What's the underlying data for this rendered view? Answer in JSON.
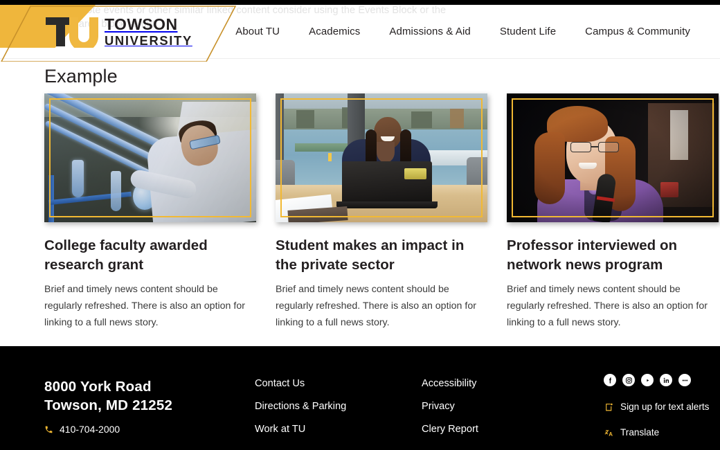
{
  "hint": {
    "line1": "To promote events or other similar linked content consider using the Events Block or the",
    "line1_link": "Events Block",
    "line2": "Link Cards block layout."
  },
  "header": {
    "logo": {
      "monogram": "TU",
      "name_top": "TOWSON",
      "name_bottom": "UNIVERSITY"
    },
    "nav": [
      {
        "label": "About TU"
      },
      {
        "label": "Academics"
      },
      {
        "label": "Admissions & Aid"
      },
      {
        "label": "Student Life"
      },
      {
        "label": "Campus & Community"
      }
    ]
  },
  "main": {
    "title": "Example",
    "cards": [
      {
        "title": "College faculty awarded research grant",
        "body": "Brief and timely news content should be regularly refreshed. There is also an option for linking to a full news story.",
        "image_alt": "researcher in white lab coat and safety goggles adjusting glass distillation apparatus in a chemistry lab"
      },
      {
        "title": "Student makes an impact in the private sector",
        "body": "Brief and timely news content should be regularly refreshed. There is also an option for linking to a full news story.",
        "image_alt": "student in navy blazer smiling behind a laptop at a conference table with a harbor view window"
      },
      {
        "title": "Professor interviewed on network news program",
        "body": "Brief and timely news content should be regularly refreshed. There is also an option for linking to a full news story.",
        "image_alt": "professor with auburn hair and glasses in a purple jacket speaking into a handheld microphone"
      }
    ]
  },
  "footer": {
    "address_line1": "8000 York Road",
    "address_line2": "Towson, MD 21252",
    "phone": "410-704-2000",
    "columns": [
      {
        "links": [
          {
            "label": "Contact Us"
          },
          {
            "label": "Directions & Parking"
          },
          {
            "label": "Work at TU"
          }
        ]
      },
      {
        "links": [
          {
            "label": "Accessibility"
          },
          {
            "label": "Privacy"
          },
          {
            "label": "Clery Report"
          }
        ]
      }
    ],
    "socials": [
      {
        "name": "facebook"
      },
      {
        "name": "instagram"
      },
      {
        "name": "youtube"
      },
      {
        "name": "linkedin"
      },
      {
        "name": "more"
      }
    ],
    "text_alerts": "Sign up for text alerts",
    "translate": "Translate"
  },
  "colors": {
    "gold": "#efb63c",
    "frame_gold": "#f2b933",
    "ink": "#231f20",
    "footer_bg": "#000000"
  }
}
